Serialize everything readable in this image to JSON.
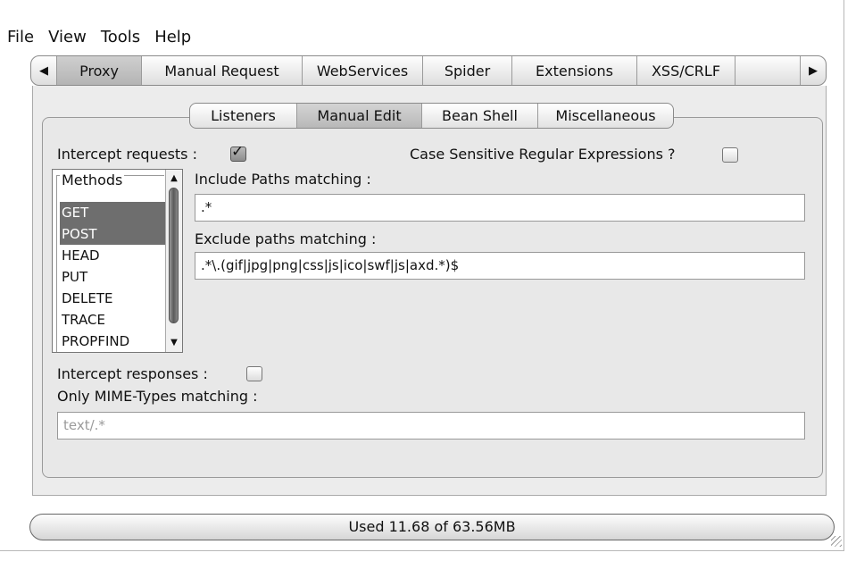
{
  "menu": [
    "File",
    "View",
    "Tools",
    "Help"
  ],
  "tabs": {
    "left_arrow": "◀",
    "right_arrow": "▶",
    "items": [
      "Proxy",
      "Manual Request",
      "WebServices",
      "Spider",
      "Extensions",
      "XSS/CRLF"
    ],
    "selected": "Proxy"
  },
  "subtabs": {
    "items": [
      "Listeners",
      "Manual Edit",
      "Bean Shell",
      "Miscellaneous"
    ],
    "selected": "Manual Edit"
  },
  "intercept_requests": {
    "label": "Intercept requests :",
    "checked": true
  },
  "case_sensitive": {
    "label": "Case Sensitive Regular Expressions ?",
    "checked": false
  },
  "methods": {
    "legend": "Methods",
    "items": [
      "GET",
      "POST",
      "HEAD",
      "PUT",
      "DELETE",
      "TRACE",
      "PROPFIND"
    ],
    "selected": [
      "GET",
      "POST"
    ]
  },
  "include_paths": {
    "label": "Include Paths matching :",
    "value": ".*"
  },
  "exclude_paths": {
    "label": "Exclude paths matching :",
    "value": ".*\\.(gif|jpg|png|css|js|ico|swf|js|axd.*)$"
  },
  "intercept_responses": {
    "label": "Intercept responses :",
    "checked": false
  },
  "mime_types": {
    "label": "Only MIME-Types matching :",
    "value": "text/.*"
  },
  "status": {
    "memory": "Used 11.68 of 63.56MB"
  }
}
